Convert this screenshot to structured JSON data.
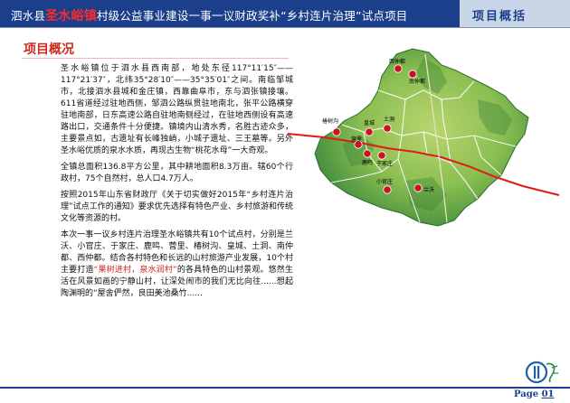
{
  "header": {
    "title_prefix": "泗水县",
    "title_highlight": "圣水峪镇",
    "title_suffix": "村级公益事业建设一事一议财政奖补“乡村连片治理”试点项目",
    "section_label": "项目概括"
  },
  "section": {
    "title": "项目概况"
  },
  "paragraphs": {
    "p1": "圣水峪镇位于泗水县西南部，地处东径117°11′15″——117°21′37″，北纬35°28′10″——35°35′01″之间。南临邹城市，北接泗水县城和金庄镇，西靠曲阜市，东与泗张镇接壤。611省道经过驻地西侧，邹泗公路纵贯驻地南北，张平公路横穿驻地南部，日东高速公路自驻地南侧经过，在驻地西侧设有高速路出口，交通条件十分便捷。镇境内山清水秀，名胜古迹众多，主要景点如，古遗址有长峰独峭，小城子遗址、三王墓等。另外圣水峪优质的泉水水质，再现古生物“桃花水母”一大奇观。",
    "p2": "全镇总面积136.8平方公里，其中耕地面积8.3万亩。辖60个行政村，75个自然村，总人口4.7万人。",
    "p3": "按照2015年山东省财政厅《关于切实做好2015年“乡村连片治理”试点工作的通知》要求优先选择有特色产业、乡村旅游和传统文化等资源的村。",
    "p4_before": "本次一事一议乡村连片治理圣水峪镇共有10个试点村，分别是兰沃、小官庄、于家庄、鹿鸣、营里、椿树沟、皇城、土洞、南仲都、西仲都。结合各村特色和长远的山村旅游产业发展，10个村主要打造",
    "p4_highlight": "“果树进村，泉水润村”",
    "p4_after": "的各具特色的山村景观。悠然生活在风景如画的宁静山村，让深处闹市的我们无比向往......想起陶渊明的“屋舍俨然，良田美池桑竹......"
  },
  "map": {
    "labels": {
      "village_1": "西仲都",
      "village_2": "南仲都",
      "village_3": "椿树沟",
      "village_4": "皇城",
      "village_5": "土洞",
      "village_6": "营里",
      "village_7": "鹿鸣",
      "village_8": "于家庄",
      "village_9": "小官庄",
      "village_10": "兰沃"
    },
    "marker_color": "#c8141e",
    "boundary_color": "#ffffff",
    "road_color": "#e01a1a"
  },
  "footer": {
    "page_prefix": "Page",
    "page_number": "01"
  }
}
